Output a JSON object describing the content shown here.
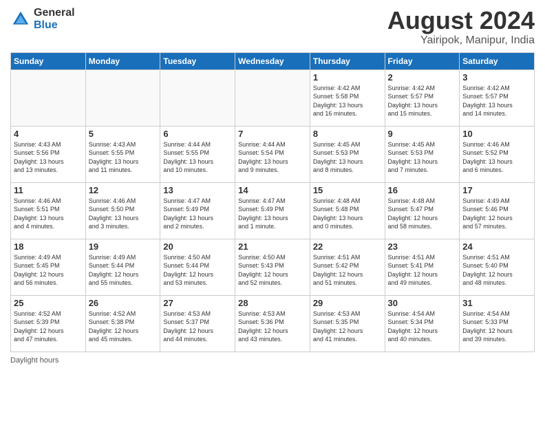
{
  "header": {
    "logo_general": "General",
    "logo_blue": "Blue",
    "title": "August 2024",
    "subtitle": "Yairipok, Manipur, India"
  },
  "days_of_week": [
    "Sunday",
    "Monday",
    "Tuesday",
    "Wednesday",
    "Thursday",
    "Friday",
    "Saturday"
  ],
  "weeks": [
    [
      {
        "day": "",
        "info": ""
      },
      {
        "day": "",
        "info": ""
      },
      {
        "day": "",
        "info": ""
      },
      {
        "day": "",
        "info": ""
      },
      {
        "day": "1",
        "info": "Sunrise: 4:42 AM\nSunset: 5:58 PM\nDaylight: 13 hours\nand 16 minutes."
      },
      {
        "day": "2",
        "info": "Sunrise: 4:42 AM\nSunset: 5:57 PM\nDaylight: 13 hours\nand 15 minutes."
      },
      {
        "day": "3",
        "info": "Sunrise: 4:42 AM\nSunset: 5:57 PM\nDaylight: 13 hours\nand 14 minutes."
      }
    ],
    [
      {
        "day": "4",
        "info": "Sunrise: 4:43 AM\nSunset: 5:56 PM\nDaylight: 13 hours\nand 13 minutes."
      },
      {
        "day": "5",
        "info": "Sunrise: 4:43 AM\nSunset: 5:55 PM\nDaylight: 13 hours\nand 11 minutes."
      },
      {
        "day": "6",
        "info": "Sunrise: 4:44 AM\nSunset: 5:55 PM\nDaylight: 13 hours\nand 10 minutes."
      },
      {
        "day": "7",
        "info": "Sunrise: 4:44 AM\nSunset: 5:54 PM\nDaylight: 13 hours\nand 9 minutes."
      },
      {
        "day": "8",
        "info": "Sunrise: 4:45 AM\nSunset: 5:53 PM\nDaylight: 13 hours\nand 8 minutes."
      },
      {
        "day": "9",
        "info": "Sunrise: 4:45 AM\nSunset: 5:53 PM\nDaylight: 13 hours\nand 7 minutes."
      },
      {
        "day": "10",
        "info": "Sunrise: 4:46 AM\nSunset: 5:52 PM\nDaylight: 13 hours\nand 6 minutes."
      }
    ],
    [
      {
        "day": "11",
        "info": "Sunrise: 4:46 AM\nSunset: 5:51 PM\nDaylight: 13 hours\nand 4 minutes."
      },
      {
        "day": "12",
        "info": "Sunrise: 4:46 AM\nSunset: 5:50 PM\nDaylight: 13 hours\nand 3 minutes."
      },
      {
        "day": "13",
        "info": "Sunrise: 4:47 AM\nSunset: 5:49 PM\nDaylight: 13 hours\nand 2 minutes."
      },
      {
        "day": "14",
        "info": "Sunrise: 4:47 AM\nSunset: 5:49 PM\nDaylight: 13 hours\nand 1 minute."
      },
      {
        "day": "15",
        "info": "Sunrise: 4:48 AM\nSunset: 5:48 PM\nDaylight: 13 hours\nand 0 minutes."
      },
      {
        "day": "16",
        "info": "Sunrise: 4:48 AM\nSunset: 5:47 PM\nDaylight: 12 hours\nand 58 minutes."
      },
      {
        "day": "17",
        "info": "Sunrise: 4:49 AM\nSunset: 5:46 PM\nDaylight: 12 hours\nand 57 minutes."
      }
    ],
    [
      {
        "day": "18",
        "info": "Sunrise: 4:49 AM\nSunset: 5:45 PM\nDaylight: 12 hours\nand 56 minutes."
      },
      {
        "day": "19",
        "info": "Sunrise: 4:49 AM\nSunset: 5:44 PM\nDaylight: 12 hours\nand 55 minutes."
      },
      {
        "day": "20",
        "info": "Sunrise: 4:50 AM\nSunset: 5:44 PM\nDaylight: 12 hours\nand 53 minutes."
      },
      {
        "day": "21",
        "info": "Sunrise: 4:50 AM\nSunset: 5:43 PM\nDaylight: 12 hours\nand 52 minutes."
      },
      {
        "day": "22",
        "info": "Sunrise: 4:51 AM\nSunset: 5:42 PM\nDaylight: 12 hours\nand 51 minutes."
      },
      {
        "day": "23",
        "info": "Sunrise: 4:51 AM\nSunset: 5:41 PM\nDaylight: 12 hours\nand 49 minutes."
      },
      {
        "day": "24",
        "info": "Sunrise: 4:51 AM\nSunset: 5:40 PM\nDaylight: 12 hours\nand 48 minutes."
      }
    ],
    [
      {
        "day": "25",
        "info": "Sunrise: 4:52 AM\nSunset: 5:39 PM\nDaylight: 12 hours\nand 47 minutes."
      },
      {
        "day": "26",
        "info": "Sunrise: 4:52 AM\nSunset: 5:38 PM\nDaylight: 12 hours\nand 45 minutes."
      },
      {
        "day": "27",
        "info": "Sunrise: 4:53 AM\nSunset: 5:37 PM\nDaylight: 12 hours\nand 44 minutes."
      },
      {
        "day": "28",
        "info": "Sunrise: 4:53 AM\nSunset: 5:36 PM\nDaylight: 12 hours\nand 43 minutes."
      },
      {
        "day": "29",
        "info": "Sunrise: 4:53 AM\nSunset: 5:35 PM\nDaylight: 12 hours\nand 41 minutes."
      },
      {
        "day": "30",
        "info": "Sunrise: 4:54 AM\nSunset: 5:34 PM\nDaylight: 12 hours\nand 40 minutes."
      },
      {
        "day": "31",
        "info": "Sunrise: 4:54 AM\nSunset: 5:33 PM\nDaylight: 12 hours\nand 39 minutes."
      }
    ]
  ],
  "footer": {
    "label": "Daylight hours"
  }
}
